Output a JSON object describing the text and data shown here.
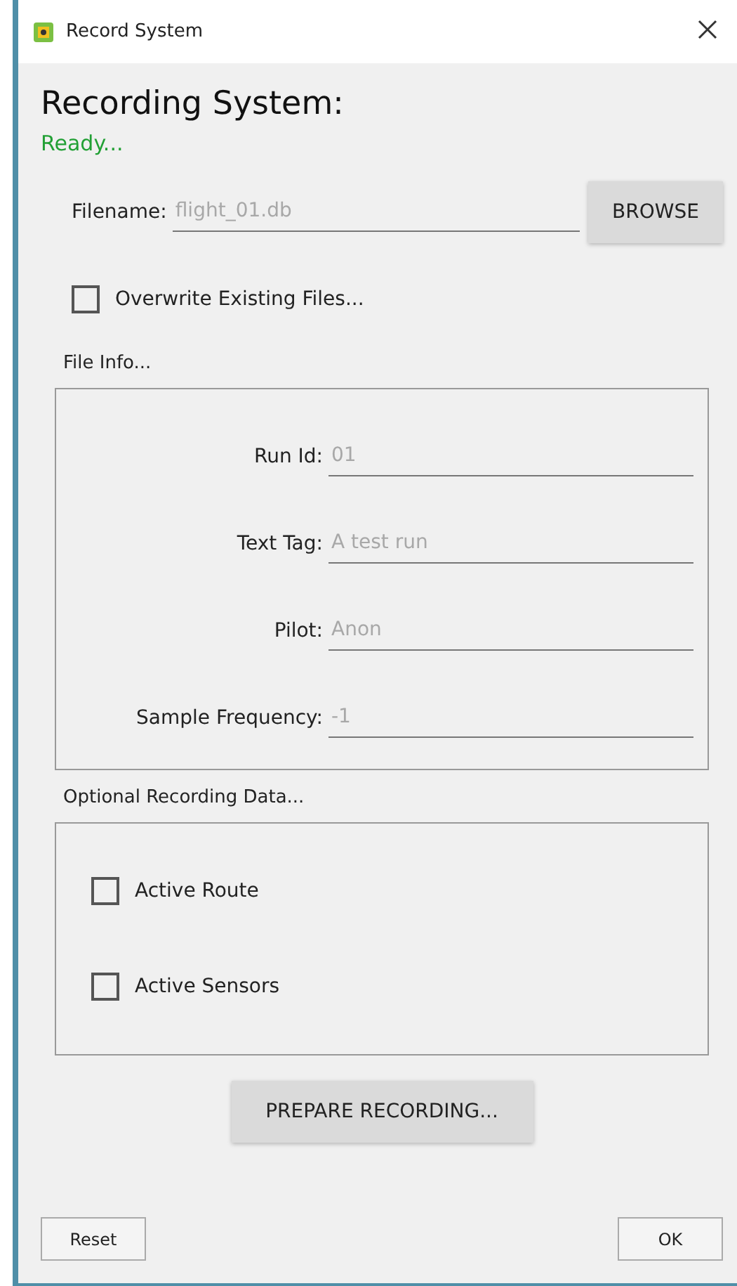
{
  "window": {
    "title": "Record System"
  },
  "heading": "Recording System:",
  "status": "Ready...",
  "filename": {
    "label": "Filename:",
    "placeholder": "flight_01.db",
    "browse": "BROWSE"
  },
  "overwrite": {
    "label": "Overwrite Existing Files...",
    "checked": false
  },
  "file_info": {
    "title": "File Info...",
    "fields": [
      {
        "label": "Run Id:",
        "placeholder": "01"
      },
      {
        "label": "Text Tag:",
        "placeholder": "A test run"
      },
      {
        "label": "Pilot:",
        "placeholder": "Anon"
      },
      {
        "label": "Sample Frequency:",
        "placeholder": "-1"
      }
    ]
  },
  "optional": {
    "title": "Optional Recording Data...",
    "options": [
      {
        "label": "Active Route",
        "checked": false
      },
      {
        "label": "Active Sensors",
        "checked": false
      }
    ]
  },
  "prepare_button": "PREPARE RECORDING...",
  "buttons": [
    "Reset",
    "OK"
  ]
}
